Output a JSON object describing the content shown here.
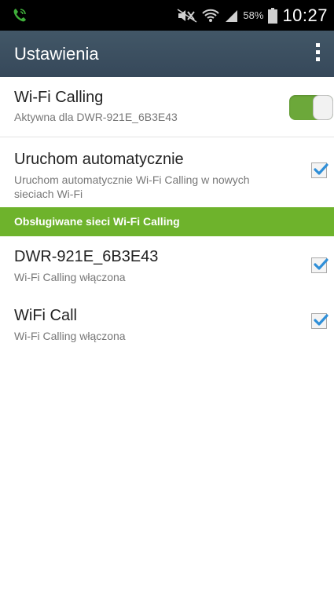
{
  "status_bar": {
    "battery_percent": "58%",
    "time": "10:27",
    "icons": [
      "wifi-calling-icon",
      "mute-icon",
      "wifi-icon",
      "signal-icon",
      "battery-icon"
    ]
  },
  "action_bar": {
    "title": "Ustawienia",
    "overflow_icon": "overflow-menu-icon"
  },
  "wifi_calling": {
    "title": "Wi-Fi Calling",
    "subtitle": "Aktywna dla DWR-921E_6B3E43",
    "enabled": true
  },
  "auto_start": {
    "title": "Uruchom automatycznie",
    "subtitle_line1": "Uruchom automatycznie Wi-Fi Calling w nowych",
    "subtitle_line2": "sieciach Wi-Fi",
    "checked": true
  },
  "section": {
    "label": "Obsługiwane sieci Wi-Fi Calling"
  },
  "networks": [
    {
      "name": "DWR-921E_6B3E43",
      "status": "Wi-Fi Calling włączona",
      "checked": true
    },
    {
      "name": "WiFi Call",
      "status": "Wi-Fi Calling włączona",
      "checked": true
    }
  ],
  "colors": {
    "status_bar": "#000000",
    "action_bar": "#3c4e5c",
    "accent_green": "#6eb32c",
    "checkmark_blue": "#2f8fd8"
  }
}
